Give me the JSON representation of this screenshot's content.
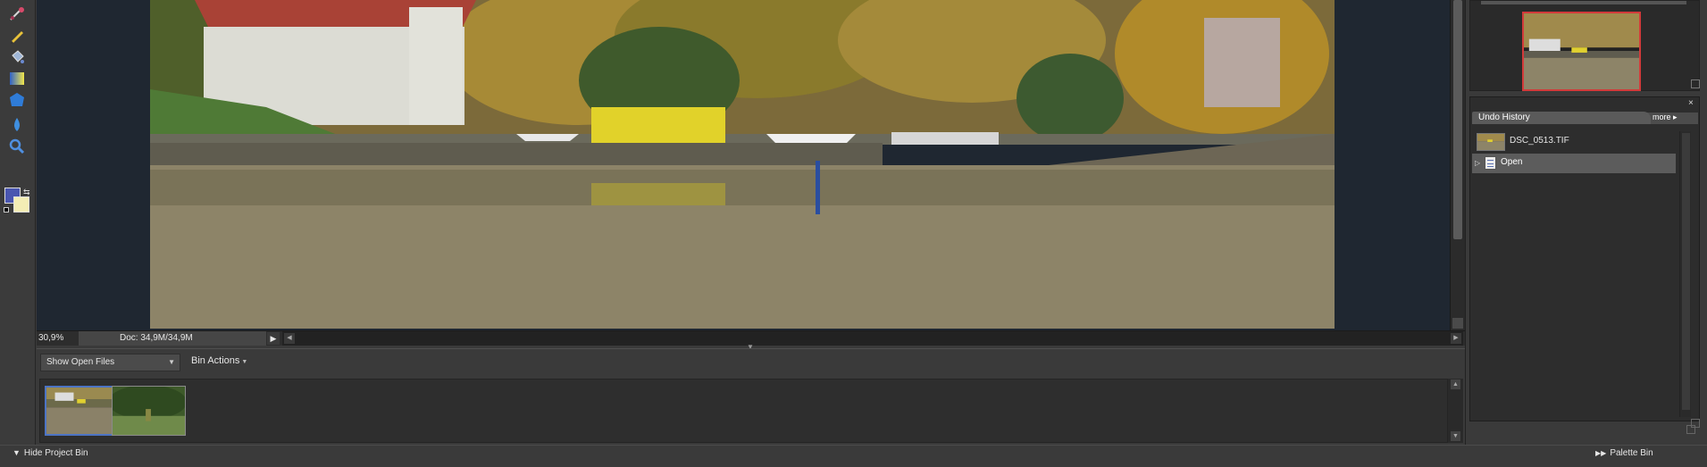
{
  "status": {
    "zoom": "30,9%",
    "doc_size": "Doc: 34,9M/34,9M"
  },
  "project_bin": {
    "show_select": "Show Open Files",
    "bin_actions_label": "Bin Actions",
    "hide_label": "Hide Project Bin",
    "thumbnails": [
      {
        "name": "harbor-photo",
        "selected": true
      },
      {
        "name": "park-photo",
        "selected": false
      }
    ]
  },
  "undo_history": {
    "tab_label": "Undo History",
    "more_label": "more ▸",
    "close_glyph": "×",
    "items": [
      {
        "label": "DSC_0513.TIF",
        "icon": "image-thumbnail-icon"
      },
      {
        "label": "Open",
        "icon": "open-document-icon",
        "selected": true
      }
    ]
  },
  "palette_bin_label": "Palette Bin",
  "tools": [
    "red-eye-brush-icon",
    "pencil-icon",
    "paint-bucket-icon",
    "gradient-icon",
    "shape-icon",
    "blur-drop-icon",
    "zoom-icon"
  ],
  "colors": {
    "foreground": "#4a56b0",
    "background": "#f3edb5",
    "selection_border": "#4d74c4",
    "navigator_border": "#d23a3a"
  }
}
